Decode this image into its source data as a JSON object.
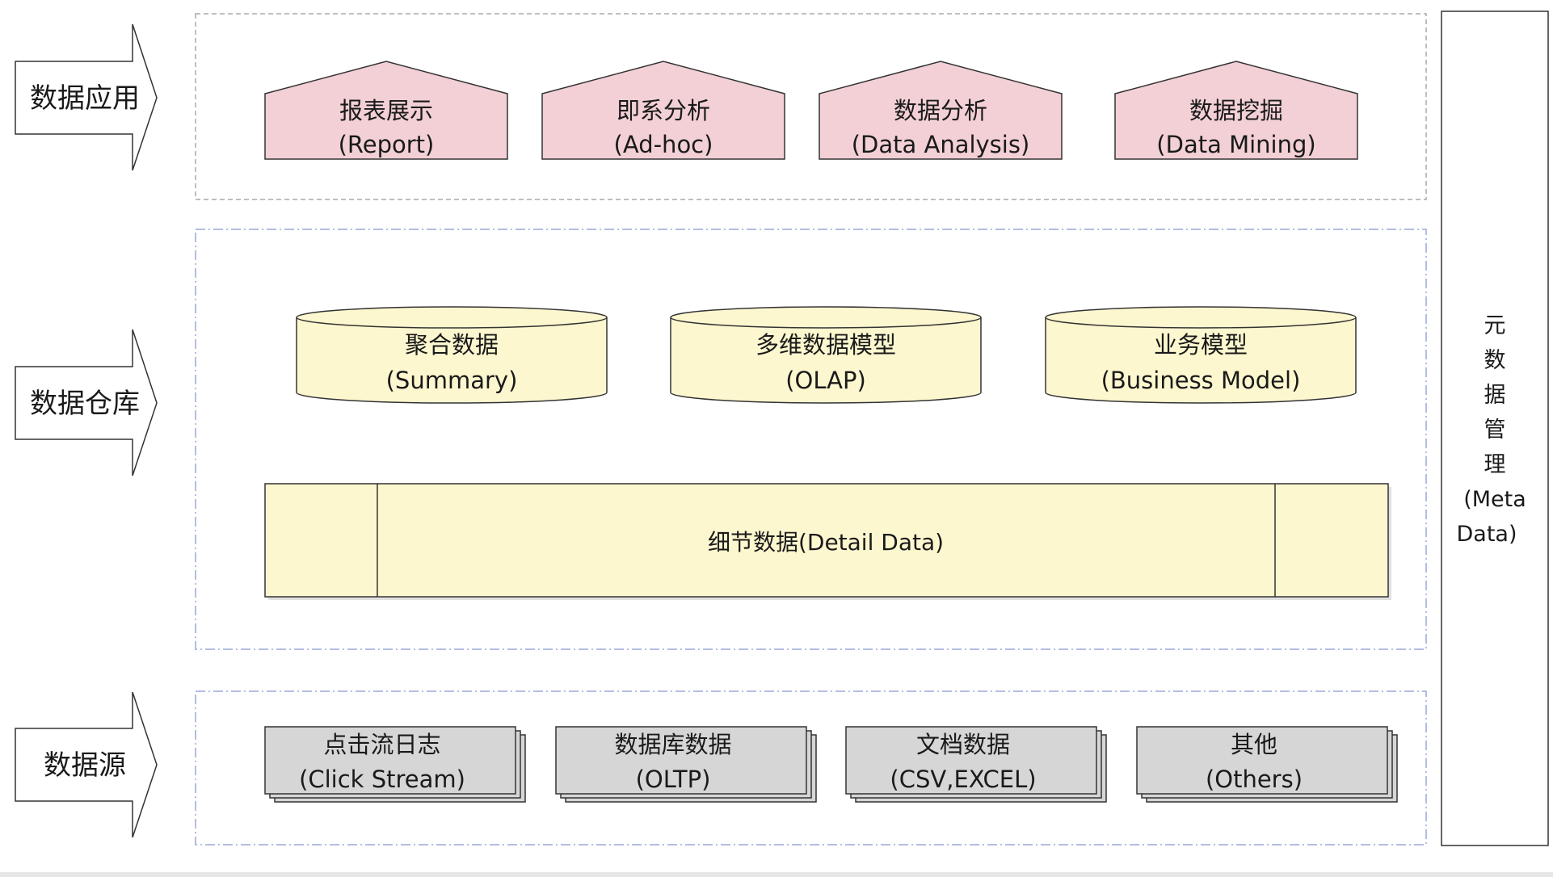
{
  "layers": {
    "application": {
      "label": "数据应用",
      "items": [
        {
          "title": "报表展示",
          "subtitle": "(Report)"
        },
        {
          "title": "即系分析",
          "subtitle": "(Ad-hoc)"
        },
        {
          "title": "数据分析",
          "subtitle": "(Data Analysis)"
        },
        {
          "title": "数据挖掘",
          "subtitle": "(Data Mining)"
        }
      ]
    },
    "warehouse": {
      "label": "数据仓库",
      "items": [
        {
          "title": "聚合数据",
          "subtitle": "(Summary)"
        },
        {
          "title": "多维数据模型",
          "subtitle": "(OLAP)"
        },
        {
          "title": "业务模型",
          "subtitle": "(Business Model)"
        }
      ],
      "detail": "细节数据(Detail Data)"
    },
    "source": {
      "label": "数据源",
      "items": [
        {
          "title": "点击流日志",
          "subtitle": "(Click Stream)"
        },
        {
          "title": "数据库数据",
          "subtitle": "(OLTP)"
        },
        {
          "title": "文档数据",
          "subtitle": "(CSV,EXCEL)"
        },
        {
          "title": "其他",
          "subtitle": "(Others)"
        }
      ]
    }
  },
  "metadata": {
    "lines": [
      "元",
      "数",
      "据",
      "管",
      "理",
      "(Meta",
      "Data)"
    ]
  },
  "colors": {
    "app_fill": "#f2d0d6",
    "warehouse_fill": "#fdf7cf",
    "source_fill": "#d6d6d6",
    "stroke": "#333333",
    "dash_gray": "#aaaaaa",
    "dash_blue": "#9aa8d8"
  }
}
